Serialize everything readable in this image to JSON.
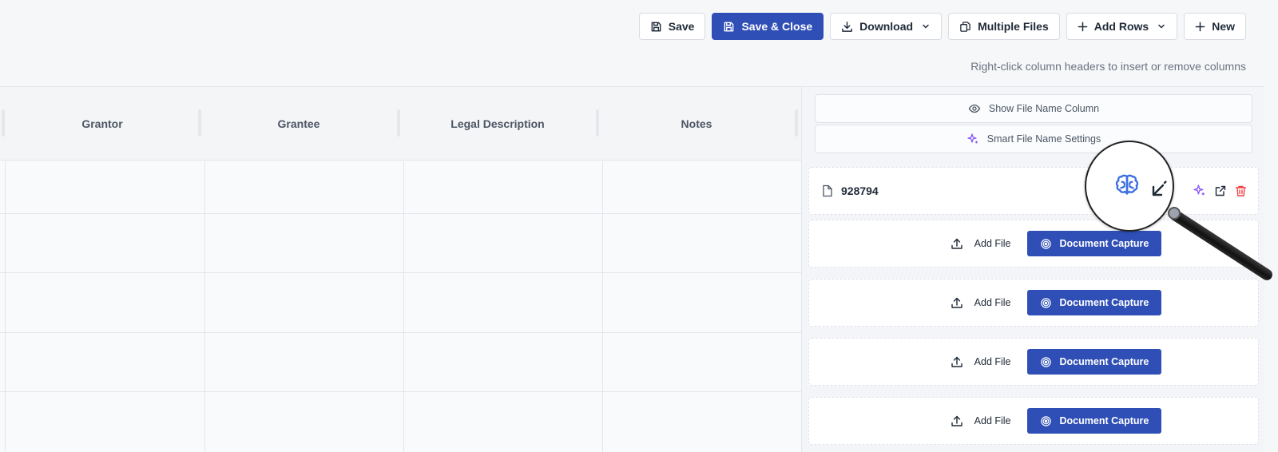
{
  "toolbar": {
    "save": "Save",
    "save_close": "Save & Close",
    "download": "Download",
    "multiple_files": "Multiple Files",
    "add_rows": "Add Rows",
    "new": "New"
  },
  "hint": "Right-click column headers to insert or remove columns",
  "columns": [
    "Grantor",
    "Grantee",
    "Legal Description",
    "Notes"
  ],
  "panel": {
    "show_file_name_column": "Show File Name Column",
    "smart_file_name_settings": "Smart File Name Settings",
    "file_name": "928794",
    "add_file": "Add File",
    "document_capture": "Document Capture"
  },
  "colors": {
    "primary": "#2f4fb6",
    "ai_purple": "#8b5cf6",
    "delete_red": "#ef4444",
    "brain_blue": "#3b6fe0"
  },
  "icons": [
    "save-icon",
    "download-icon",
    "chevron-down-icon",
    "files-icon",
    "plus-icon",
    "eye-icon",
    "sparkle-icon",
    "file-icon",
    "brain-icon",
    "arrow-icon",
    "external-link-icon",
    "trash-icon",
    "upload-icon",
    "target-icon",
    "magnifier-icon"
  ]
}
